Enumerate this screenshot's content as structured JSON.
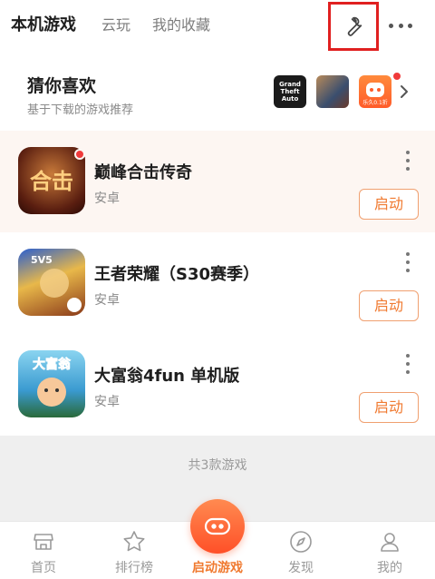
{
  "top_tabs": [
    {
      "label": "本机游戏",
      "active": true
    },
    {
      "label": "云玩",
      "active": false
    },
    {
      "label": "我的收藏",
      "active": false
    }
  ],
  "toolbar": {
    "wrench_icon": "wrench-icon",
    "more_icon": "more-horizontal-icon"
  },
  "recommend": {
    "title": "猜你喜欢",
    "subtitle": "基于下载的游戏推荐",
    "thumb_a_text": "Grand Theft Auto",
    "thumb_c_text": "乐久0.1折"
  },
  "games": [
    {
      "name": "巅峰合击传奇",
      "platform": "安卓",
      "action": "启动",
      "icon_text": "合击",
      "highlight": true,
      "has_badge": true
    },
    {
      "name": "王者荣耀（S30赛季）",
      "platform": "安卓",
      "action": "启动",
      "icon_text": "5V5",
      "highlight": false,
      "has_badge": false
    },
    {
      "name": "大富翁4fun 单机版",
      "platform": "安卓",
      "action": "启动",
      "icon_text": "大富翁",
      "highlight": false,
      "has_badge": false
    }
  ],
  "count_text": "共3款游戏",
  "bottom_nav": [
    {
      "label": "首页",
      "icon": "home-icon"
    },
    {
      "label": "排行榜",
      "icon": "star-icon"
    },
    {
      "label": "启动游戏",
      "icon": "gamepad-icon",
      "active": true
    },
    {
      "label": "发现",
      "icon": "compass-icon"
    },
    {
      "label": "我的",
      "icon": "user-icon"
    }
  ],
  "colors": {
    "accent": "#f07a30",
    "highlight_bg": "#fdf6f2",
    "badge": "#f03a3a",
    "annotation": "#e02020"
  }
}
